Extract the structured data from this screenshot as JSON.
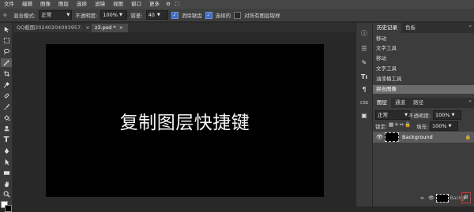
{
  "menu": [
    "文件",
    "编辑",
    "图像",
    "图层",
    "选择",
    "滤镜",
    "视图",
    "窗口",
    "更多"
  ],
  "options": {
    "blend_label": "混合模式:",
    "blend_value": "正常",
    "opacity_label": "不透明度:",
    "opacity_value": "100%",
    "tolerance_label": "容差:",
    "tolerance_value": "40",
    "antialias_label": "消除锯齿",
    "contiguous_label": "连续的",
    "sample_all_label": "对所有图层取样"
  },
  "tabs": [
    {
      "label": "QQ截图20240204093957.",
      "close": "×"
    },
    {
      "label": "z3.psd *",
      "close": "×"
    }
  ],
  "canvas": {
    "text": "复制图层快捷键"
  },
  "right_icons": [
    "ⓘ",
    "☰",
    "✎",
    "¶",
    "CSS",
    "▣"
  ],
  "panel": {
    "history_tabs": [
      "历史记录",
      "色板"
    ],
    "history": [
      "移动",
      "文字工具",
      "移动",
      "文字工具",
      "油漆桶工具",
      "拼合图像"
    ],
    "layer_tabs": [
      "图层",
      "通道",
      "路径"
    ],
    "layer_blend": "正常",
    "layer_opacity_label": "不透明度:",
    "layer_opacity": "100%",
    "lock_label": "锁定:",
    "fill_label": "填充:",
    "fill_value": "100%",
    "layer_name": "Background"
  },
  "colors": {
    "accent": "#3a6fc4",
    "highlight_box": "#e03030"
  }
}
